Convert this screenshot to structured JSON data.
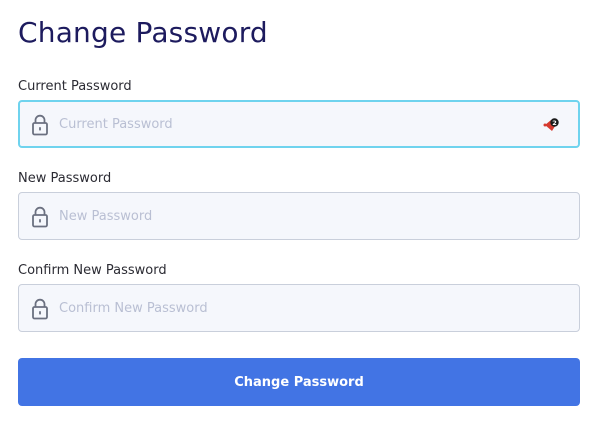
{
  "page": {
    "title": "Change Password"
  },
  "form": {
    "fields": [
      {
        "label": "Current Password",
        "placeholder": "Current Password",
        "value": "",
        "icon": "lock-icon",
        "focused": true
      },
      {
        "label": "New Password",
        "placeholder": "New Password",
        "value": "",
        "icon": "lock-icon",
        "focused": false
      },
      {
        "label": "Confirm New Password",
        "placeholder": "Confirm New Password",
        "value": "",
        "icon": "lock-icon",
        "focused": false
      }
    ],
    "password_manager_badge": "2",
    "submit_label": "Change Password"
  },
  "colors": {
    "title": "#1d1b5e",
    "button": "#4274e4",
    "focus_border": "#6fd3ee",
    "field_bg": "#f5f7fc"
  }
}
